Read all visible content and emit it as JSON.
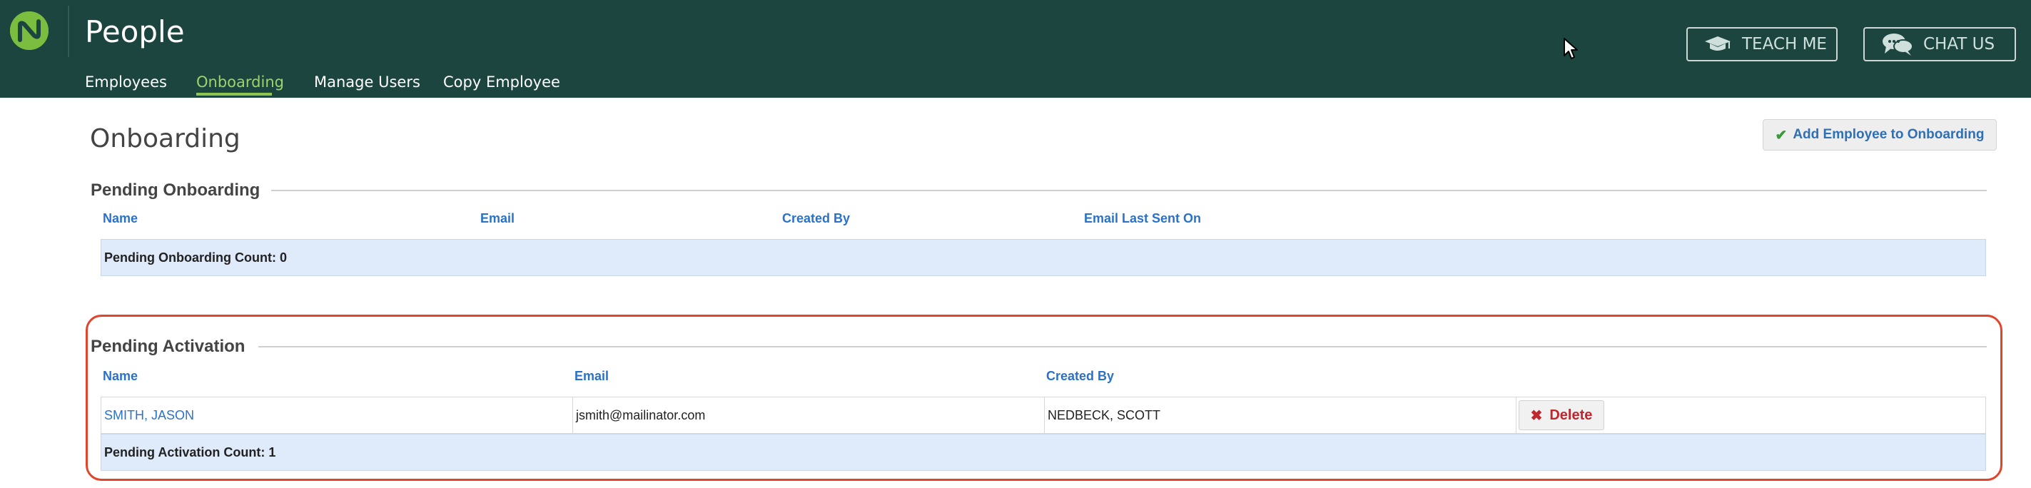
{
  "header": {
    "app_title": "People",
    "nav": [
      {
        "label": "Employees"
      },
      {
        "label": "Onboarding",
        "active": true
      },
      {
        "label": "Manage Users"
      },
      {
        "label": "Copy Employee"
      }
    ],
    "teach_me_label": "TEACH ME",
    "chat_us_label": "CHAT US"
  },
  "page": {
    "title": "Onboarding",
    "add_button_label": "Add Employee to Onboarding"
  },
  "pending_onboarding": {
    "title": "Pending Onboarding",
    "columns": [
      "Name",
      "Email",
      "Created By",
      "Email Last Sent On"
    ],
    "count_text": "Pending Onboarding Count: 0"
  },
  "pending_activation": {
    "title": "Pending Activation",
    "columns": [
      "Name",
      "Email",
      "Created By"
    ],
    "rows": [
      {
        "name": "SMITH, JASON",
        "email": "jsmith@mailinator.com",
        "created_by": "NEDBECK, SCOTT",
        "action": "Delete"
      }
    ],
    "count_text": "Pending Activation Count: 1"
  },
  "colors": {
    "header_bg": "#1c4540",
    "accent_green": "#8dc54f",
    "link_blue": "#2a72c9",
    "delete_red": "#c0262d",
    "highlight_red": "#e0442b"
  },
  "icons": {
    "logo": "company-logo",
    "teach_me": "graduation-cap-icon",
    "chat_us": "chat-bubbles-icon",
    "add": "check-icon",
    "delete": "x-icon"
  }
}
